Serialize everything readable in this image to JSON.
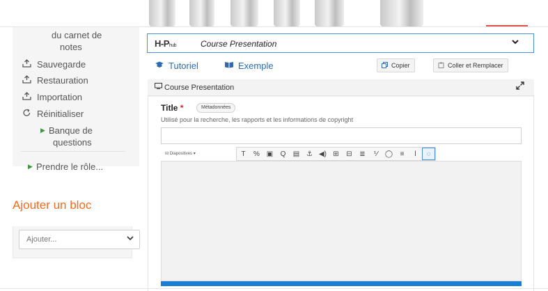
{
  "sidebar": {
    "items": [
      {
        "label_line1": "du carnet de",
        "label_line2": "notes",
        "icon": "none"
      },
      {
        "label": "Sauvegarde",
        "icon": "upload-tray-icon"
      },
      {
        "label": "Restauration",
        "icon": "upload-tray-icon"
      },
      {
        "label": "Importation",
        "icon": "upload-tray-icon"
      },
      {
        "label": "Réinitialiser",
        "icon": "refresh-icon"
      },
      {
        "label_line1": "Banque de",
        "label_line2": "questions",
        "icon": "triangle-right-icon"
      },
      {
        "label": "Prendre le rôle...",
        "icon": "triangle-right-icon"
      }
    ]
  },
  "block": {
    "title": "Ajouter un bloc",
    "select_value": "Ajouter...",
    "accent": "#f26b21"
  },
  "editor": {
    "library": {
      "logo_main": "H-P",
      "logo_sub": "hub",
      "name": "Course Presentation"
    },
    "links": {
      "tutorial": "Tutoriel",
      "example": "Exemple"
    },
    "buttons": {
      "copy": "Copier",
      "paste_replace": "Coller et Remplacer"
    },
    "panel_title": "Course Presentation",
    "field": {
      "label": "Title",
      "required_mark": "*",
      "meta_tag": "Métadonnées",
      "help": "Utilisé pour la recherche, les rapports et les informations de copyright",
      "value": ""
    },
    "toolbar": {
      "slides_label": "Diapositives",
      "tools": [
        "T",
        "%",
        "▣",
        "Q",
        "▤",
        "⚓",
        "◀)",
        "⊞",
        "⊟",
        "≣",
        "⅟",
        "◯",
        "≡",
        "ⅼ",
        "◌"
      ]
    },
    "colors": {
      "link": "#2b6cb0",
      "progress": "#1a7fd4",
      "required": "#d9212c"
    }
  }
}
